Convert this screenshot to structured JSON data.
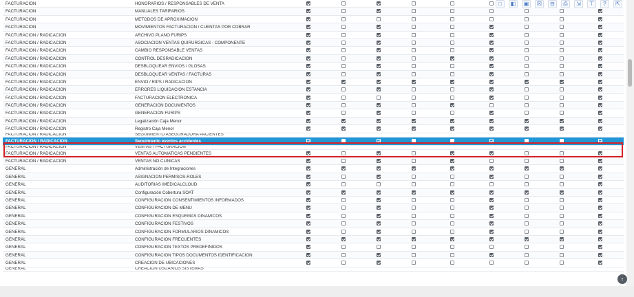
{
  "toolbar": {
    "icons": [
      "new-icon",
      "folder-icon",
      "save-icon",
      "close-icon",
      "delete-icon",
      "print-icon",
      "export-icon",
      "filter-icon",
      "help-icon",
      "exit-icon"
    ],
    "glyphs": [
      "□",
      "◧",
      "▣",
      "☒",
      "⊟",
      "⎙",
      "⇲",
      "⊤",
      "?",
      "⇱"
    ]
  },
  "rows": [
    {
      "module": "FACTURACION",
      "name": "HONORARIOS / RESPONSABLES DE VENTA",
      "checks": [
        1,
        0,
        1,
        0,
        0,
        0,
        0,
        0,
        1
      ]
    },
    {
      "module": "FACTURACION",
      "name": "MANUALES TARIFARIOS",
      "checks": [
        1,
        0,
        1,
        0,
        0,
        0,
        0,
        0,
        1
      ]
    },
    {
      "module": "FACTURACION",
      "name": "METODOS DE APROXIMACION",
      "checks": [
        1,
        0,
        0,
        0,
        0,
        0,
        0,
        0,
        1
      ]
    },
    {
      "module": "FACTURACION",
      "name": "MOVIMIENTOS FACTURACION / CUENTAS POR COBRAR",
      "checks": [
        1,
        0,
        1,
        0,
        0,
        1,
        0,
        0,
        1
      ]
    },
    {
      "module": "FACTURACION / RADICACION",
      "name": "ARCHIVO PLANO FURIPS",
      "checks": [
        1,
        0,
        1,
        0,
        0,
        1,
        0,
        0,
        1
      ]
    },
    {
      "module": "FACTURACION / RADICACION",
      "name": "ASOCIACION VENTAS QUIRURGICAS - COMPONENTE",
      "checks": [
        1,
        0,
        1,
        0,
        0,
        1,
        0,
        0,
        1
      ]
    },
    {
      "module": "FACTURACION / RADICACION",
      "name": "CAMBIO RESPONSABLE VENTAS",
      "checks": [
        1,
        0,
        1,
        0,
        0,
        1,
        0,
        0,
        1
      ]
    },
    {
      "module": "FACTURACION / RADICACION",
      "name": "CONTROL DESRADICACION",
      "checks": [
        1,
        0,
        1,
        0,
        1,
        1,
        0,
        0,
        1
      ]
    },
    {
      "module": "FACTURACION / RADICACION",
      "name": "DESBLOQUEAR ENVIOS / GLOSAS",
      "checks": [
        1,
        0,
        1,
        0,
        0,
        1,
        0,
        0,
        1
      ]
    },
    {
      "module": "FACTURACION / RADICACION",
      "name": "DESBLOQUEAR VENTAS / FACTURAS",
      "checks": [
        1,
        0,
        1,
        0,
        0,
        1,
        0,
        0,
        1
      ]
    },
    {
      "module": "FACTURACION / RADICACION",
      "name": "ENVIO / RIPS / RADICACION",
      "checks": [
        1,
        1,
        1,
        1,
        1,
        1,
        1,
        1,
        1
      ]
    },
    {
      "module": "FACTURACION / RADICACION",
      "name": "ERRORES LIQUIDACION ESTANCIA",
      "checks": [
        1,
        0,
        1,
        0,
        0,
        1,
        0,
        0,
        1
      ]
    },
    {
      "module": "FACTURACION / RADICACION",
      "name": "FACTURACION ELECTRONICA",
      "checks": [
        1,
        0,
        0,
        0,
        0,
        1,
        0,
        0,
        1
      ]
    },
    {
      "module": "FACTURACION / RADICACION",
      "name": "GENERACION DOCUMENTOS",
      "checks": [
        1,
        0,
        1,
        0,
        1,
        0,
        0,
        0,
        1
      ]
    },
    {
      "module": "FACTURACION / RADICACION",
      "name": "GENERACION FURIPS",
      "checks": [
        1,
        0,
        1,
        0,
        0,
        1,
        0,
        0,
        1
      ]
    },
    {
      "module": "FACTURACION / RADICACION",
      "name": "Legalización Caja Menor",
      "checks": [
        1,
        1,
        1,
        1,
        1,
        1,
        1,
        1,
        1
      ]
    },
    {
      "module": "FACTURACION / RADICACION",
      "name": "Registro Caja Menor",
      "checks": [
        1,
        1,
        1,
        1,
        1,
        1,
        1,
        1,
        1
      ]
    }
  ],
  "peek_above": {
    "module": "FACTURACION / RADICACION",
    "name": "SEGUIMIENTO ASEGURADORA PACIENTES"
  },
  "selected_row": {
    "module": "FACTURACION / RADICACION",
    "name": "Seguimiento eventos accidentes",
    "checks": [
      1,
      0,
      1,
      0,
      0,
      1,
      0,
      0,
      1
    ]
  },
  "peek_below": {
    "module": "FACTURACION / RADICACION",
    "name": "VENTAS / FACTURACION"
  },
  "rows_after": [
    {
      "module": "FACTURACION / RADICACION",
      "name": "VENTAS AUTOMATICAS PENDIENTES",
      "checks": [
        1,
        0,
        1,
        0,
        1,
        1,
        0,
        0,
        1
      ]
    },
    {
      "module": "FACTURACION / RADICACION",
      "name": "VENTAS NO CLINICAS",
      "checks": [
        1,
        0,
        1,
        0,
        1,
        0,
        0,
        0,
        1
      ]
    },
    {
      "module": "GENERAL",
      "name": "Administración de Integraciones",
      "checks": [
        1,
        1,
        1,
        1,
        1,
        1,
        1,
        1,
        1
      ]
    },
    {
      "module": "GENERAL",
      "name": "ASIGNACION PERMISOS-ROLES",
      "checks": [
        1,
        0,
        1,
        0,
        0,
        1,
        0,
        0,
        1
      ]
    },
    {
      "module": "GENERAL",
      "name": "AUDITORIAS IMEDICALCLOUD",
      "checks": [
        1,
        0,
        0,
        0,
        0,
        0,
        0,
        0,
        1
      ]
    },
    {
      "module": "GENERAL",
      "name": "Configuración Cobertura SOAT",
      "checks": [
        1,
        1,
        1,
        1,
        1,
        1,
        1,
        1,
        1
      ]
    },
    {
      "module": "GENERAL",
      "name": "CONFIGURACION CONSENTIMIENTOS INFORMADOS",
      "checks": [
        1,
        0,
        1,
        0,
        0,
        1,
        0,
        0,
        1
      ]
    },
    {
      "module": "GENERAL",
      "name": "CONFIGURACION DE MENU",
      "checks": [
        1,
        0,
        1,
        0,
        0,
        1,
        0,
        0,
        1
      ]
    },
    {
      "module": "GENERAL",
      "name": "CONFIGURACION ESQUEMAS DINAMICOS",
      "checks": [
        1,
        0,
        1,
        0,
        0,
        1,
        0,
        0,
        1
      ]
    },
    {
      "module": "GENERAL",
      "name": "CONFIGURACION FESTIVOS",
      "checks": [
        1,
        0,
        1,
        0,
        0,
        1,
        0,
        0,
        1
      ]
    },
    {
      "module": "GENERAL",
      "name": "CONFIGURACION FORMULARIOS DINAMICOS",
      "checks": [
        1,
        0,
        1,
        0,
        0,
        1,
        0,
        0,
        1
      ]
    },
    {
      "module": "GENERAL",
      "name": "CONFIGURACION FRECUENTES",
      "checks": [
        1,
        1,
        1,
        1,
        1,
        1,
        1,
        1,
        1
      ]
    },
    {
      "module": "GENERAL",
      "name": "CONFIGURACION TEXTOS PREDEFINIDOS",
      "checks": [
        1,
        0,
        0,
        0,
        0,
        0,
        0,
        0,
        1
      ]
    },
    {
      "module": "GENERAL",
      "name": "CONFIGURACION TIPOS DOCUMENTOS IDENTIFICACION",
      "checks": [
        1,
        0,
        1,
        0,
        0,
        1,
        0,
        0,
        1
      ]
    },
    {
      "module": "GENERAL",
      "name": "CREACION DE UBICACIONES",
      "checks": [
        1,
        0,
        1,
        0,
        0,
        0,
        0,
        0,
        1
      ]
    }
  ],
  "peek_bottom": {
    "module": "GENERAL",
    "name": "CREACION USUARIOS SISTEMAS"
  },
  "scroll_button": {
    "icon": "arrow-up-circle-icon",
    "glyph": "↑"
  },
  "colors": {
    "selected": "#2196d6",
    "highlight_border": "#d42026"
  }
}
